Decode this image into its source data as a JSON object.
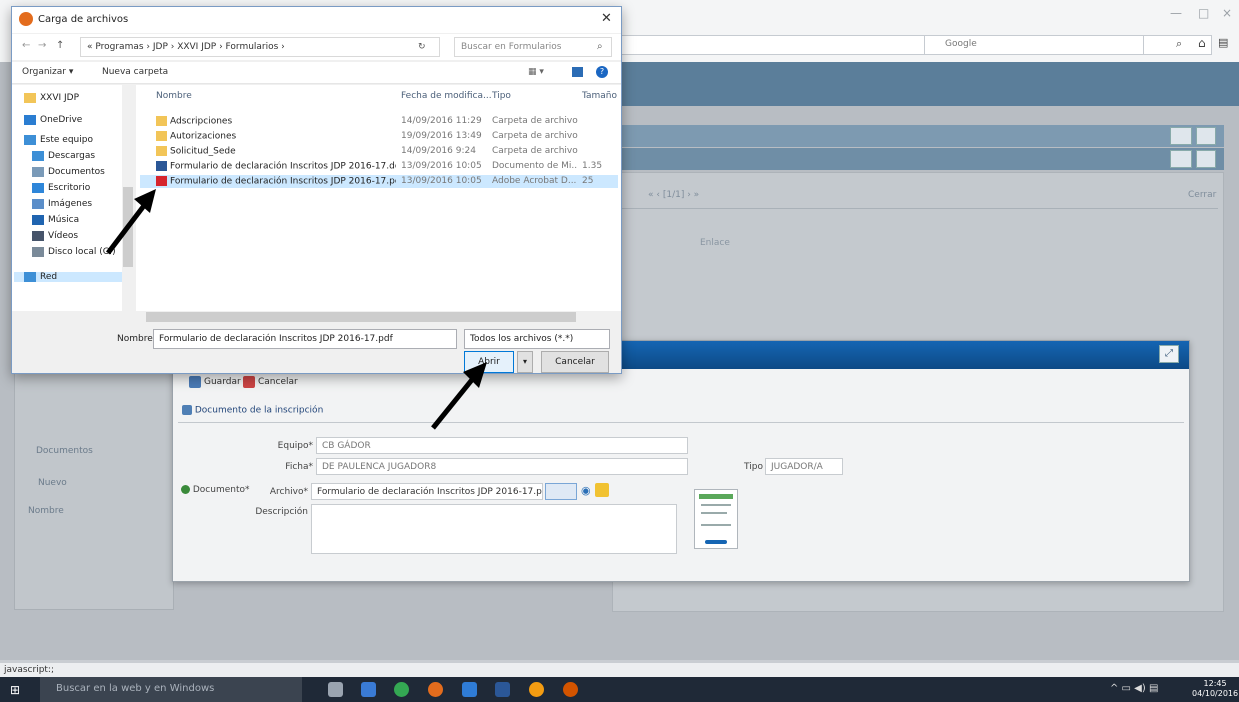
{
  "browser": {
    "search_engine": "Google",
    "status_text": "javascript:;",
    "controls": [
      "—",
      "□",
      "×"
    ]
  },
  "background_app": {
    "pager": "« ‹ [1/1] › »",
    "close_label": "Cerrar",
    "column_label": "Enlace",
    "left_tab": "Documentos",
    "left_new": "Nuevo",
    "left_col": "Nombre"
  },
  "form": {
    "toolbar": {
      "save": "Guardar",
      "cancel": "Cancelar"
    },
    "section_title": "Documento de la inscripción",
    "equipo_label": "Equipo*",
    "equipo_value": "CB GÁDOR",
    "ficha_label": "Ficha*",
    "ficha_value": "DE PAULENCA JUGADOR8",
    "tipo_label": "Tipo",
    "tipo_value": "JUGADOR/A",
    "documento_label": "Documento*",
    "archivo_label": "Archivo*",
    "archivo_value": "Formulario de declaración Inscritos JDP 2016-17.pdf",
    "descripcion_label": "Descripción"
  },
  "dialog": {
    "title": "Carga de archivos",
    "breadcrumb": "« Programas › JDP › XXVI JDP › Formularios ›",
    "search_placeholder": "Buscar en Formularios",
    "organize": "Organizar ▾",
    "new_folder": "Nueva carpeta",
    "nav_items": [
      {
        "label": "XXVI JDP",
        "icon": "folder-icon",
        "color": "#f2c558"
      },
      {
        "label": "OneDrive",
        "icon": "cloud-icon",
        "color": "#2a7dd1"
      },
      {
        "label": "Este equipo",
        "icon": "computer-icon",
        "color": "#3d8fd6"
      },
      {
        "label": "Descargas",
        "icon": "download-icon",
        "color": "#3d8fd6"
      },
      {
        "label": "Documentos",
        "icon": "document-icon",
        "color": "#7a9ab8"
      },
      {
        "label": "Escritorio",
        "icon": "desktop-icon",
        "color": "#2e86d9"
      },
      {
        "label": "Imágenes",
        "icon": "images-icon",
        "color": "#5b8ec9"
      },
      {
        "label": "Música",
        "icon": "music-icon",
        "color": "#1f64b0"
      },
      {
        "label": "Vídeos",
        "icon": "video-icon",
        "color": "#46546a"
      },
      {
        "label": "Disco local (C:)",
        "icon": "drive-icon",
        "color": "#7a8a99"
      },
      {
        "label": "Red",
        "icon": "network-icon",
        "color": "#3d8fd6"
      }
    ],
    "columns": {
      "name": "Nombre",
      "date": "Fecha de modifica...",
      "type": "Tipo",
      "size": "Tamaño"
    },
    "files": [
      {
        "name": "Adscripciones",
        "date": "14/09/2016 11:29",
        "type": "Carpeta de archivos",
        "size": "",
        "icon": "folder-icon",
        "color": "#f2c558"
      },
      {
        "name": "Autorizaciones",
        "date": "19/09/2016 13:49",
        "type": "Carpeta de archivos",
        "size": "",
        "icon": "folder-icon",
        "color": "#f2c558"
      },
      {
        "name": "Solicitud_Sede",
        "date": "14/09/2016 9:24",
        "type": "Carpeta de archivos",
        "size": "",
        "icon": "folder-icon",
        "color": "#f2c558"
      },
      {
        "name": "Formulario de declaración Inscritos JDP 2016-17.doc",
        "date": "13/09/2016 10:05",
        "type": "Documento de Mi...",
        "size": "1.35",
        "icon": "word-doc-icon",
        "color": "#2b5797"
      },
      {
        "name": "Formulario de declaración Inscritos JDP 2016-17.pdf",
        "date": "13/09/2016 10:05",
        "type": "Adobe Acrobat D...",
        "size": "25",
        "icon": "pdf-icon",
        "color": "#d6252d"
      }
    ],
    "name_label": "Nombre:",
    "name_value": "Formulario de declaración Inscritos JDP 2016-17.pdf",
    "filter": "Todos los archivos (*.*)",
    "open": "Abrir",
    "cancel": "Cancelar"
  },
  "taskbar": {
    "search": "Buscar en la web y en Windows",
    "time": "12:45",
    "date": "04/10/2016"
  }
}
